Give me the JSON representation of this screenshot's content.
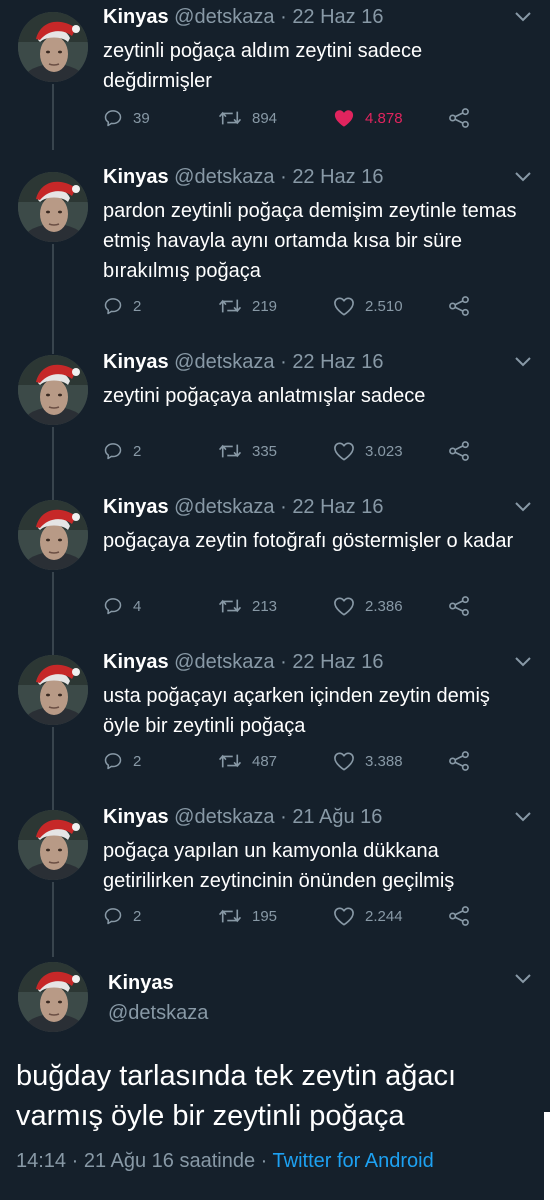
{
  "colors": {
    "background": "#15202b",
    "muted": "#8899a6",
    "like": "#e0245e",
    "link": "#1da1f2"
  },
  "tweets": [
    {
      "name": "Kinyas",
      "handle": "@detskaza",
      "sep": "·",
      "date": "22 Haz 16",
      "text": "zeytinli poğaça aldım zeytini sadece değdirmişler",
      "replies": "39",
      "retweets": "894",
      "likes": "4.878",
      "liked": true
    },
    {
      "name": "Kinyas",
      "handle": "@detskaza",
      "sep": "·",
      "date": "22 Haz 16",
      "text": "pardon zeytinli poğaça demişim zeytinle temas etmiş havayla aynı ortamda kısa bir süre bırakılmış poğaça",
      "replies": "2",
      "retweets": "219",
      "likes": "2.510",
      "liked": false
    },
    {
      "name": "Kinyas",
      "handle": "@detskaza",
      "sep": "·",
      "date": "22 Haz 16",
      "text": "zeytini poğaçaya anlatmışlar sadece",
      "replies": "2",
      "retweets": "335",
      "likes": "3.023",
      "liked": false
    },
    {
      "name": "Kinyas",
      "handle": "@detskaza",
      "sep": "·",
      "date": "22 Haz 16",
      "text": "poğaçaya zeytin fotoğrafı göstermişler o kadar",
      "replies": "4",
      "retweets": "213",
      "likes": "2.386",
      "liked": false
    },
    {
      "name": "Kinyas",
      "handle": "@detskaza",
      "sep": "·",
      "date": "22 Haz 16",
      "text": "usta poğaçayı açarken içinden zeytin demiş öyle bir zeytinli poğaça",
      "replies": "2",
      "retweets": "487",
      "likes": "3.388",
      "liked": false
    },
    {
      "name": "Kinyas",
      "handle": "@detskaza",
      "sep": "·",
      "date": "21 Ağu 16",
      "text": "poğaça yapılan un kamyonla dükkana getirilirken zeytincinin önünden geçilmiş",
      "replies": "2",
      "retweets": "195",
      "likes": "2.244",
      "liked": false
    }
  ],
  "main_tweet": {
    "name": "Kinyas",
    "handle": "@detskaza",
    "text": "buğday tarlasında tek zeytin ağacı varmış öyle bir zeytinli poğaça",
    "time": "14:14 · 21 Ağu 16 saatinde ·",
    "source": "Twitter for Android"
  }
}
